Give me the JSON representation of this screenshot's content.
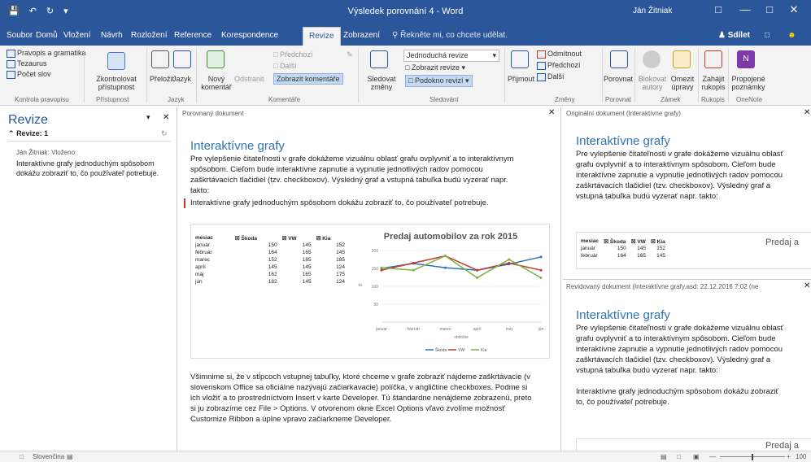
{
  "window": {
    "title": "Výsledek porovnání 4 - Word",
    "user": "Ján Žitniak",
    "qat": [
      "💾",
      "↶",
      "↻",
      "▾"
    ],
    "controls": [
      "□",
      "—",
      "□",
      "✕"
    ]
  },
  "tabs": [
    "Soubor",
    "Domů",
    "Vložení",
    "Návrh",
    "Rozložení",
    "Reference",
    "Korespondence",
    "Revize",
    "Zobrazení"
  ],
  "active_tab": "Revize",
  "tell_me": "Řekněte mi, co chcete udělat.",
  "share": "Sdílet",
  "ribbon": {
    "proofing": {
      "items": [
        "Pravopis a gramatika",
        "Tezaurus",
        "Počet slov"
      ],
      "label": "Kontrola pravopisu"
    },
    "accessibility": {
      "button": "Zkontrolovat přístupnost",
      "label": "Přístupnost"
    },
    "language": {
      "translate": "Přeložit",
      "language": "Jazyk",
      "label": "Jazyk"
    },
    "comments": {
      "new": "Nový komentář",
      "delete": "Odstranit",
      "previous": "Předchozí",
      "next": "Další",
      "show": "Zobrazit komentáře",
      "label": "Komentáře"
    },
    "tracking": {
      "track": "Sledovat změny",
      "simple": "Jednoduchá revize",
      "show_markup": "Zobrazit revize",
      "reviewing_pane": "Podokno revizí",
      "label": "Sledování"
    },
    "changes": {
      "accept": "Přijmout",
      "reject": "Odmítnout",
      "previous": "Předchozí",
      "next": "Další",
      "label": "Změny"
    },
    "compare": {
      "button": "Porovnat",
      "label": "Porovnat"
    },
    "protect": {
      "block": "Blokovat autory",
      "restrict": "Omezit úpravy",
      "label": "Zámek"
    },
    "ink": {
      "button": "Zahájit rukopis",
      "label": "Rukopis"
    },
    "onenote": {
      "button": "Propojené poznámky",
      "label": "OneNote"
    }
  },
  "revisions_pane": {
    "title": "Revize",
    "count": "Revize: 1",
    "close": "✕",
    "author": "Ján Žitniak: Vloženo",
    "text": "Interaktívne grafy jednoduchým spôsobom dokážu zobraziť to, čo používateľ potrebuje."
  },
  "compared": {
    "header": "Porovnaný dokument",
    "heading": "Interaktívne grafy",
    "para1": "Pre vylepšenie čitateľnosti v grafe dokážeme vizuálnu oblasť grafu ovplyvniť a to interaktívnym spôsobom. Cieľom bude interaktívne zapnutie a vypnutie jednotlivých radov pomocou zaškrtávacích tlačidiel (tzv. checkboxov). Výsledný graf a vstupná tabuľka budú vyzerať napr. takto:",
    "inserted": "Interaktívne grafy jednoduchým spôsobom dokážu zobraziť to, čo používateľ potrebuje.",
    "para2": "Všimnime si, že v stĺpcoch vstupnej tabuľky, ktoré chceme v grafe zobraziť nájdeme zaškrtávacie (v slovenskom Office sa oficiálne nazývajú začiarkavacie) políčka, v angličtine checkboxes. Podme si ich vložiť a to prostredníctvom Insert v karte Developer. Tú štandardne nenájdeme zobrazenú, preto si ju zobrazíme cez File > Options. V otvorenom okne Excel Options vľavo zvolíme možnosť Customize Ribbon a úplne vpravo začiarkneme Developer."
  },
  "table": {
    "headers": [
      "mesiac",
      "☒ Škoda",
      "☒ VW",
      "☒ Kia"
    ],
    "rows": [
      [
        "január",
        "150",
        "145",
        "152"
      ],
      [
        "február",
        "164",
        "165",
        "145"
      ],
      [
        "marec",
        "152",
        "185",
        "185"
      ],
      [
        "apríl",
        "145",
        "145",
        "124"
      ],
      [
        "máj",
        "162",
        "165",
        "175"
      ],
      [
        "jún",
        "182",
        "145",
        "124"
      ]
    ]
  },
  "chart_data": {
    "type": "line",
    "title": "Predaj automobilov za rok 2015",
    "categories": [
      "január",
      "február",
      "marec",
      "apríl",
      "máj",
      "jún"
    ],
    "xlabel": "obdobie",
    "ylabel": "ks",
    "ylim": [
      0,
      200
    ],
    "yticks": [
      50,
      100,
      150,
      200
    ],
    "series": [
      {
        "name": "Škoda",
        "color": "#2e75b6",
        "values": [
          150,
          164,
          152,
          145,
          162,
          182
        ]
      },
      {
        "name": "VW",
        "color": "#c0392b",
        "values": [
          145,
          165,
          185,
          145,
          165,
          145
        ]
      },
      {
        "name": "Kia",
        "color": "#7cb342",
        "values": [
          152,
          145,
          185,
          124,
          175,
          124
        ]
      }
    ],
    "legend": "bottom"
  },
  "original": {
    "header": "Originální dokument (Interaktívne grafy)",
    "heading": "Interaktívne grafy",
    "para": "Pre vylepšenie čitateľnosti v grafe dokážeme vizuálnu oblasť grafu ovplyvniť a to interaktívnym spôsobom. Cieľom bude interaktívne zapnutie a vypnutie jednotlivých radov pomocou zaškrtávacích tlačidiel (tzv. checkboxov). Výsledný graf a vstupná tabuľka budú vyzerať napr. takto:",
    "chart_title": "Predaj a"
  },
  "revised": {
    "header": "Revidovaný dokument (Interaktívne grafy.asd: 22.12.2016 7:02 (ne",
    "heading": "Interaktívne grafy",
    "para": "Pre vylepšenie čitateľnosti v grafe dokážeme vizuálnu oblasť grafu ovplyvniť a to interaktívnym spôsobom. Cieľom bude interaktívne zapnutie a vypnutie jednotlivých radov pomocou zaškrtávacích tlačidiel (tzv. checkboxov). Výsledný graf a vstupná tabuľka budú vyzerať napr. takto:",
    "inserted": "Interaktívne grafy jednoduchým spôsobom dokážu zobraziť to, čo používateľ potrebuje.",
    "chart_title": "Predaj a"
  },
  "status": {
    "language": "Slovenčina",
    "zoom": "100"
  }
}
